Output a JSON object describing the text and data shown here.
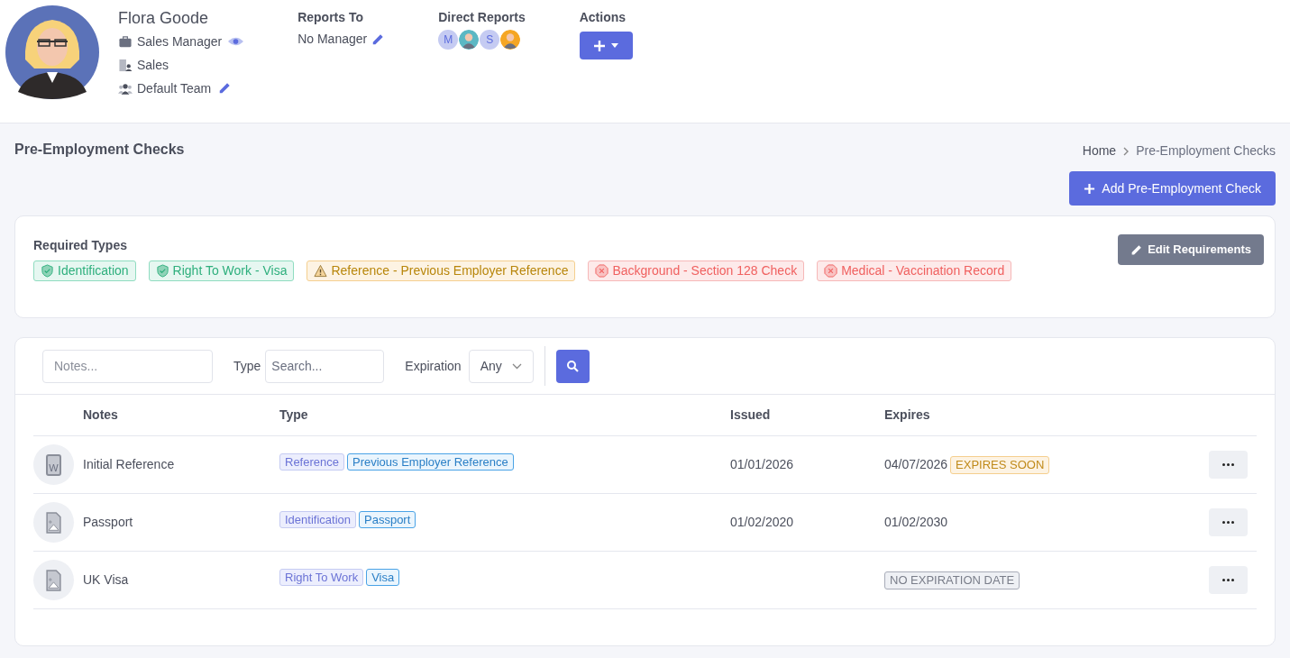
{
  "profile": {
    "name": "Flora Goode",
    "details": [
      {
        "kind": "role",
        "text": "Sales Manager",
        "viewable": true,
        "editable": false
      },
      {
        "kind": "department",
        "text": "Sales",
        "viewable": false,
        "editable": false
      },
      {
        "kind": "team",
        "text": "Default Team",
        "viewable": false,
        "editable": true
      }
    ]
  },
  "reports_to": {
    "label": "Reports To",
    "value": "No Manager"
  },
  "direct_reports": {
    "label": "Direct Reports",
    "avatars": [
      {
        "kind": "initial",
        "text": "M"
      },
      {
        "kind": "figure",
        "color": "#5bb8c4"
      },
      {
        "kind": "initial",
        "text": "S"
      },
      {
        "kind": "figure",
        "color": "#f5a623"
      }
    ]
  },
  "actions": {
    "label": "Actions"
  },
  "page": {
    "title": "Pre-Employment Checks",
    "breadcrumbs": [
      "Home",
      "Pre-Employment Checks"
    ],
    "add_button": "Add Pre-Employment Check"
  },
  "required": {
    "title": "Required Types",
    "edit_button": "Edit Requirements",
    "types": [
      {
        "kind": "met",
        "text": "Identification"
      },
      {
        "kind": "met",
        "text": "Right To Work - Visa"
      },
      {
        "kind": "warning",
        "text": "Reference - Previous Employer Reference"
      },
      {
        "kind": "missing",
        "text": "Background - Section 128 Check"
      },
      {
        "kind": "missing",
        "text": "Medical - Vaccination Record"
      }
    ]
  },
  "filters": {
    "notes_placeholder": "Notes...",
    "type_label": "Type",
    "type_placeholder": "Search...",
    "expiration_label": "Expiration",
    "expiration_value": "Any"
  },
  "table": {
    "columns": [
      "Notes",
      "Type",
      "Issued",
      "Expires"
    ],
    "rows": [
      {
        "file": {
          "kind": "document",
          "letter": "W"
        },
        "notes": "Initial Reference",
        "category": "Reference",
        "subtype": "Previous Employer Reference",
        "issued": "01/01/2026",
        "expires": "04/07/2026",
        "badge": {
          "kind": "soon",
          "text": "EXPIRES SOON"
        }
      },
      {
        "file": {
          "kind": "image"
        },
        "notes": "Passport",
        "category": "Identification",
        "subtype": "Passport",
        "issued": "01/02/2020",
        "expires": "01/02/2030"
      },
      {
        "file": {
          "kind": "image"
        },
        "notes": "UK Visa",
        "category": "Right To Work",
        "subtype": "Visa",
        "badge": {
          "kind": "none",
          "text": "NO EXPIRATION DATE"
        }
      }
    ]
  }
}
